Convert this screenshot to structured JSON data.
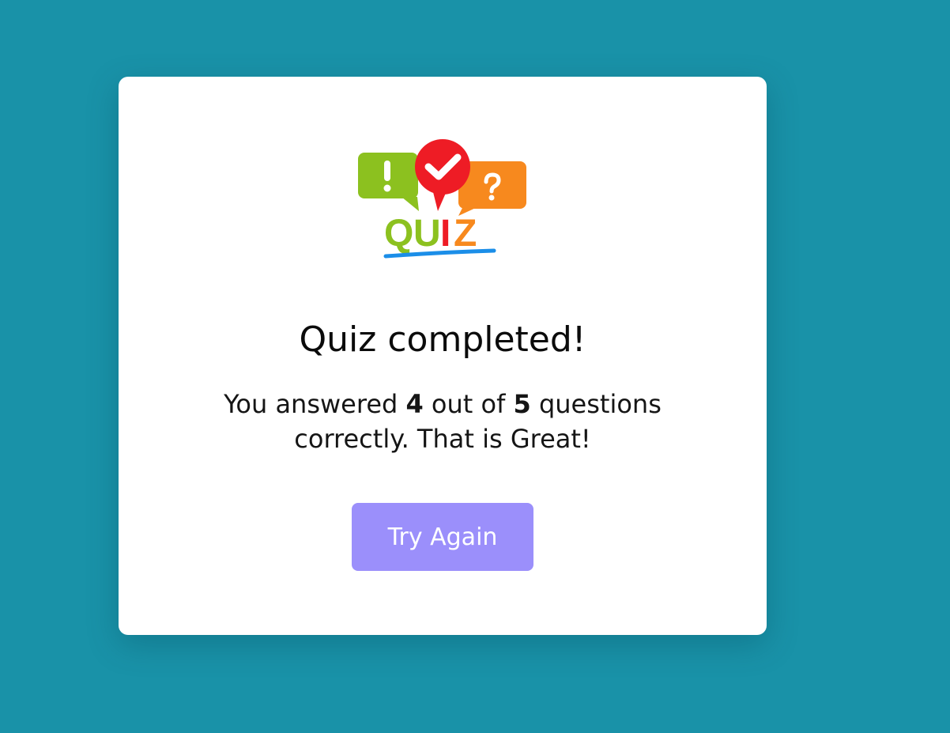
{
  "logo": {
    "text": "QUIZ",
    "icon_names": [
      "exclamation-bubble-icon",
      "checkmark-bubble-icon",
      "question-bubble-icon"
    ]
  },
  "result": {
    "title": "Quiz completed!",
    "prefix": "You answered ",
    "correct": "4",
    "middle": " out of ",
    "total": "5",
    "suffix": " questions correctly. That is Great!"
  },
  "button": {
    "label": "Try Again"
  },
  "colors": {
    "background": "#1992a8",
    "card": "#ffffff",
    "button": "#9b8ffb",
    "logo_green": "#8cc11f",
    "logo_red": "#ee1c25",
    "logo_orange": "#f7891e",
    "logo_blue": "#1b8ee8"
  }
}
